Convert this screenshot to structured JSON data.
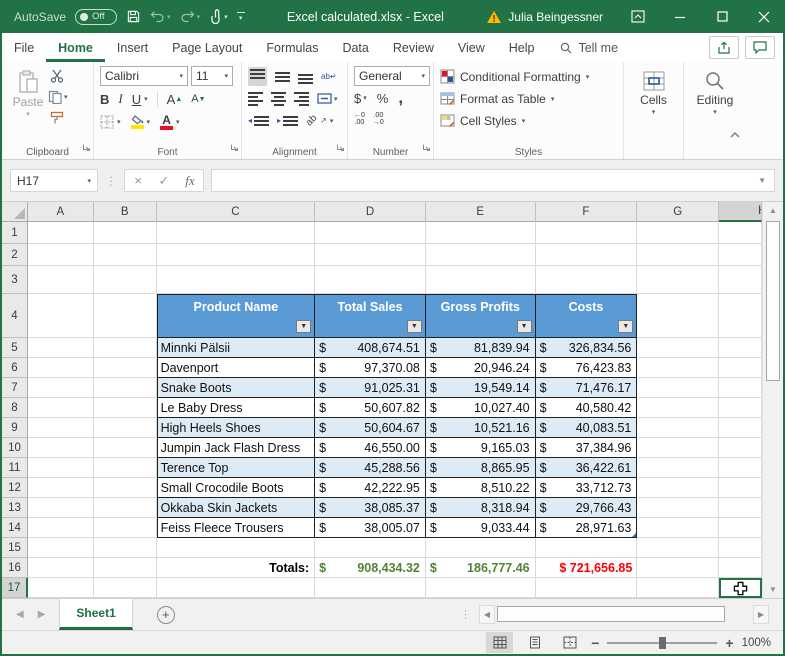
{
  "titlebar": {
    "autosave_label": "AutoSave",
    "autosave_state": "Off",
    "title": "Excel calculated.xlsx  -  Excel",
    "user": "Julia Beingessner"
  },
  "tabs": {
    "items": [
      "File",
      "Home",
      "Insert",
      "Page Layout",
      "Formulas",
      "Data",
      "Review",
      "View",
      "Help"
    ],
    "tellme": "Tell me"
  },
  "ribbon": {
    "clipboard": {
      "label": "Clipboard",
      "paste": "Paste"
    },
    "font": {
      "label": "Font",
      "name": "Calibri",
      "size": "11",
      "bold": "B",
      "italic": "I",
      "underline": "U",
      "grow": "A",
      "shrink": "A",
      "color_letter": "A"
    },
    "alignment": {
      "label": "Alignment",
      "orientation": "ab"
    },
    "number": {
      "label": "Number",
      "format": "General",
      "currency": "$",
      "percent": "%",
      "comma": ","
    },
    "styles": {
      "label": "Styles",
      "conditional": "Conditional Formatting",
      "format_table": "Format as Table",
      "cell_styles": "Cell Styles"
    },
    "cells": {
      "label": "Cells"
    },
    "editing": {
      "label": "Editing"
    }
  },
  "formula_bar": {
    "name_box": "H17",
    "fx": "fx",
    "value": ""
  },
  "grid": {
    "columns": [
      "A",
      "B",
      "C",
      "D",
      "E",
      "F",
      "G",
      "H"
    ],
    "rows": [
      "1",
      "2",
      "3",
      "4",
      "5",
      "6",
      "7",
      "8",
      "9",
      "10",
      "11",
      "12",
      "13",
      "14",
      "15",
      "16",
      "17"
    ]
  },
  "table": {
    "currency": "$",
    "headers": [
      "Product Name",
      "Total Sales",
      "Gross Profits",
      "Costs"
    ],
    "rows": [
      {
        "name": "Minnki Pälsii",
        "sales": "408,674.51",
        "gross": "81,839.94",
        "costs": "326,834.56"
      },
      {
        "name": "Davenport",
        "sales": "97,370.08",
        "gross": "20,946.24",
        "costs": "76,423.83"
      },
      {
        "name": "Snake Boots",
        "sales": "91,025.31",
        "gross": "19,549.14",
        "costs": "71,476.17"
      },
      {
        "name": "Le Baby Dress",
        "sales": "50,607.82",
        "gross": "10,027.40",
        "costs": "40,580.42"
      },
      {
        "name": "High Heels Shoes",
        "sales": "50,604.67",
        "gross": "10,521.16",
        "costs": "40,083.51"
      },
      {
        "name": "Jumpin Jack Flash Dress",
        "sales": "46,550.00",
        "gross": "9,165.03",
        "costs": "37,384.96"
      },
      {
        "name": "Terence Top",
        "sales": "45,288.56",
        "gross": "8,865.95",
        "costs": "36,422.61"
      },
      {
        "name": "Small Crocodile Boots",
        "sales": "42,222.95",
        "gross": "8,510.22",
        "costs": "33,712.73"
      },
      {
        "name": "Okkaba Skin Jackets",
        "sales": "38,085.37",
        "gross": "8,318.94",
        "costs": "29,766.43"
      },
      {
        "name": "Feiss Fleece Trousers",
        "sales": "38,005.07",
        "gross": "9,033.44",
        "costs": "28,971.63"
      }
    ],
    "totals_label": "Totals:",
    "totals_sales": "908,434.32",
    "totals_gross": "186,777.46",
    "totals_costs": "$ 721,656.85"
  },
  "sheet": {
    "active_tab": "Sheet1"
  },
  "status": {
    "zoom": "100%"
  }
}
